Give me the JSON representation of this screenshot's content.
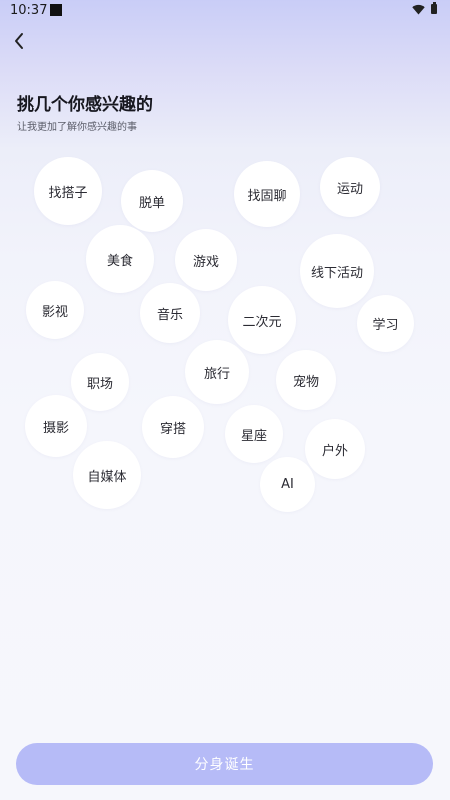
{
  "status_bar": {
    "time": "10:37",
    "icons": [
      "wifi-icon",
      "battery-icon"
    ]
  },
  "header": {
    "back_icon": "chevron-left-icon",
    "title": "挑几个你感兴趣的",
    "subtitle": "让我更加了解你感兴趣的事"
  },
  "interests": [
    {
      "label": "找搭子"
    },
    {
      "label": "脱单"
    },
    {
      "label": "找固聊"
    },
    {
      "label": "运动"
    },
    {
      "label": "美食"
    },
    {
      "label": "游戏"
    },
    {
      "label": "线下活动"
    },
    {
      "label": "影视"
    },
    {
      "label": "音乐"
    },
    {
      "label": "二次元"
    },
    {
      "label": "学习"
    },
    {
      "label": "职场"
    },
    {
      "label": "旅行"
    },
    {
      "label": "宠物"
    },
    {
      "label": "摄影"
    },
    {
      "label": "穿搭"
    },
    {
      "label": "星座"
    },
    {
      "label": "户外"
    },
    {
      "label": "自媒体"
    },
    {
      "label": "AI"
    }
  ],
  "footer": {
    "submit_label": "分身诞生"
  },
  "colors": {
    "button_bg": "#b6bbf7",
    "bubble_bg": "#ffffff",
    "title_text": "#17171f"
  }
}
